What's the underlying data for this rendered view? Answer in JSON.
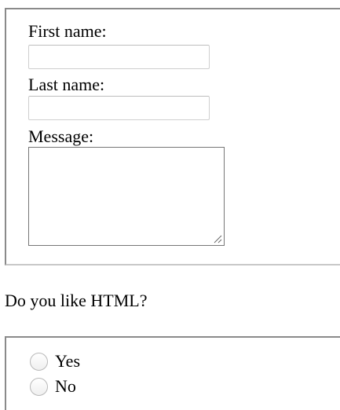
{
  "form": {
    "first_name": {
      "label": "First name:",
      "value": "",
      "placeholder": ""
    },
    "last_name": {
      "label": "Last name:",
      "value": "",
      "placeholder": ""
    },
    "message": {
      "label": "Message:",
      "value": ""
    }
  },
  "question": {
    "text": "Do you like HTML?",
    "options": [
      {
        "label": "Yes",
        "selected": false
      },
      {
        "label": "No",
        "selected": false
      }
    ]
  },
  "icons": {
    "resize_grip": "resize-grip-icon",
    "radio_unchecked": "radio-unchecked-icon"
  },
  "colors": {
    "border_dark": "#8a8a8a",
    "border_light": "#c8c8c8",
    "input_border": "#cfcfcf",
    "textarea_border": "#767676"
  }
}
